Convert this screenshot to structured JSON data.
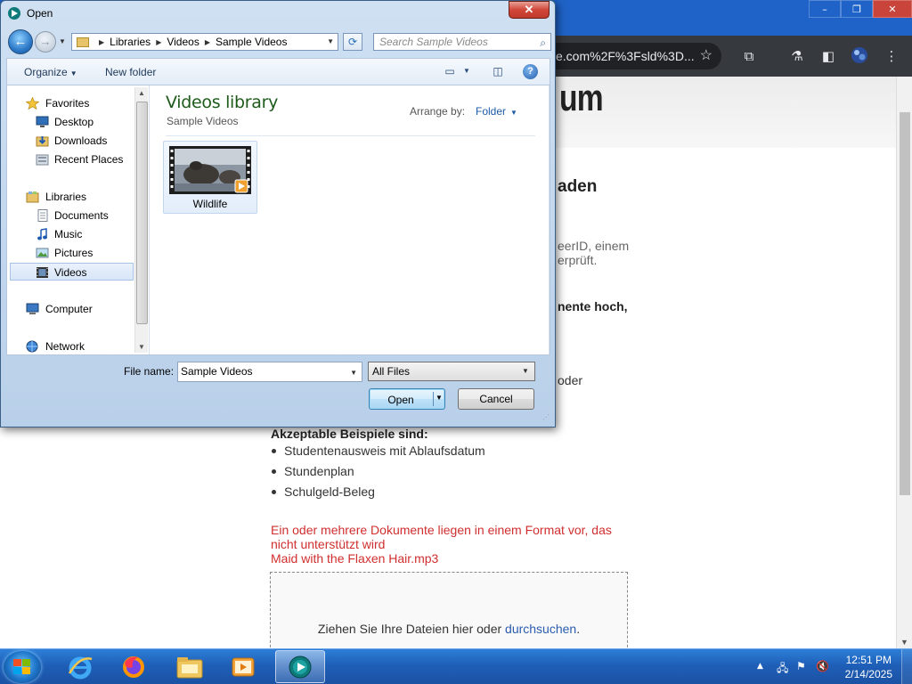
{
  "dialog": {
    "title": "Open",
    "close_label": "✕",
    "address": {
      "crumbs": [
        "Libraries",
        "Videos",
        "Sample Videos"
      ]
    },
    "search_placeholder": "Search Sample Videos",
    "toolbar": {
      "organize_label": "Organize",
      "new_folder_label": "New folder",
      "help_label": "?"
    },
    "navigation": {
      "items": [
        {
          "label": "Favorites",
          "icon": "star-icon"
        },
        {
          "label": "Desktop",
          "icon": "desktop-icon"
        },
        {
          "label": "Downloads",
          "icon": "downloads-icon"
        },
        {
          "label": "Recent Places",
          "icon": "recent-places-icon"
        },
        {
          "label": "Libraries",
          "icon": "libraries-icon"
        },
        {
          "label": "Documents",
          "icon": "documents-icon"
        },
        {
          "label": "Music",
          "icon": "music-icon"
        },
        {
          "label": "Pictures",
          "icon": "pictures-icon"
        },
        {
          "label": "Videos",
          "icon": "videos-icon",
          "selected": true
        },
        {
          "label": "Computer",
          "icon": "computer-icon"
        },
        {
          "label": "Network",
          "icon": "network-icon"
        }
      ]
    },
    "library": {
      "title": "Videos library",
      "subtitle": "Sample Videos",
      "arrange_label": "Arrange by:",
      "arrange_value": "Folder"
    },
    "files": [
      {
        "name": "Wildlife"
      }
    ],
    "file_name_label": "File name:",
    "file_name_value": "Sample Videos",
    "file_type_value": "All Files",
    "open_label": "Open",
    "cancel_label": "Cancel"
  },
  "browser": {
    "url_fragment": "e.com%2F%3Fsld%3D...",
    "window_controls": [
      "–",
      "❐",
      "✕"
    ],
    "page": {
      "header_fragment": "um",
      "heading_fragment": "aden",
      "paragraph_line1": "eerID, einem",
      "paragraph_line2": "erprüft.",
      "bold_fragment": "nente hoch,",
      "oder_fragment": "oder",
      "examples_heading": "Akzeptable Beispiele sind:",
      "examples": [
        "Studentenausweis mit Ablaufsdatum",
        "Stundenplan",
        "Schulgeld-Beleg"
      ],
      "error_line1": "Ein oder mehrere Dokumente liegen in einem Format vor, das",
      "error_line2": "nicht unterstützt wird",
      "error_line3": "Maid with the Flaxen Hair.mp3",
      "dropzone_text": "Ziehen Sie Ihre Dateien hier oder ",
      "dropzone_link": "durchsuchen",
      "dropzone_suffix": "."
    }
  },
  "taskbar": {
    "apps": [
      {
        "name": "internet-explorer-icon"
      },
      {
        "name": "firefox-icon"
      },
      {
        "name": "file-explorer-icon"
      },
      {
        "name": "media-player-icon"
      },
      {
        "name": "active-app-icon",
        "active": true
      }
    ],
    "clock": {
      "time": "12:51 PM",
      "date": "2/14/2025"
    }
  }
}
